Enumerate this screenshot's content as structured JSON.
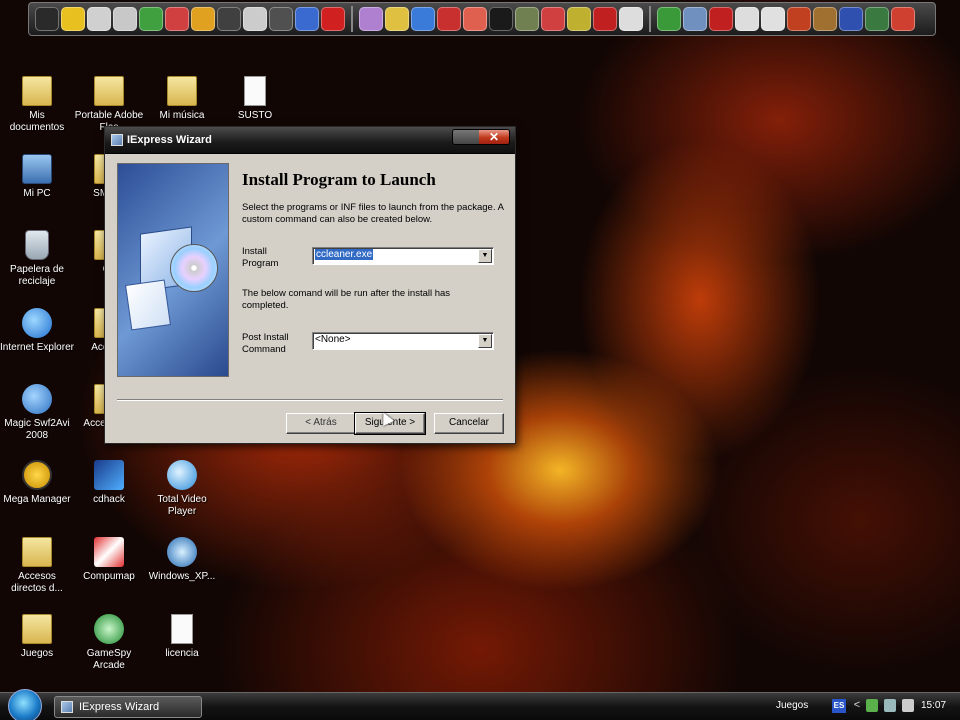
{
  "dock": {
    "icons": [
      "nes-icon",
      "cd-icon",
      "disc-icon",
      "flag-icon",
      "plant-icon",
      "mushroom-icon",
      "tool-icon",
      "linux-icon",
      "film-icon",
      "ninja-icon",
      "plane-icon",
      "circle-icon",
      "feather-icon",
      "camera-icon",
      "globe-icon",
      "car-icon",
      "paint-icon",
      "star-icon",
      "ninja2-icon",
      "flash-icon",
      "player-icon",
      "stop-icon",
      "wolf-icon",
      "globe2-icon",
      "map-icon",
      "cursor-icon",
      "disc2-icon",
      "monkey-icon",
      "warrior-icon",
      "wave-icon",
      "ball-icon",
      "net-icon",
      "orb-icon"
    ]
  },
  "desktop": {
    "icons": [
      {
        "label": "Mis\ndocumentos",
        "type": "folder"
      },
      {
        "label": "Portable Adobe Flas",
        "type": "folder"
      },
      {
        "label": "Mi música",
        "type": "folder"
      },
      {
        "label": "SUSTO",
        "type": "file"
      },
      {
        "label": "Mi PC",
        "type": "comp"
      },
      {
        "label": "SMV C",
        "type": "folder"
      },
      {
        "label": "Papelera de reciclaje",
        "type": "bin"
      },
      {
        "label": "Co",
        "type": "folder"
      },
      {
        "label": "Internet Explorer",
        "type": "ie"
      },
      {
        "label": "Acces a",
        "type": "folder"
      },
      {
        "label": "Magic Swf2Avi 2008",
        "type": "flash"
      },
      {
        "label": "Acces a vid",
        "type": "folder"
      },
      {
        "label": "Mega Manager",
        "type": "mega"
      },
      {
        "label": "cdhack",
        "type": "cd"
      },
      {
        "label": "Total Video Player",
        "type": "play"
      },
      {
        "label": "Accesos directos d...",
        "type": "folder"
      },
      {
        "label": "Compumap",
        "type": "compumap"
      },
      {
        "label": "Windows_XP...",
        "type": "winxp"
      },
      {
        "label": "Juegos",
        "type": "folder"
      },
      {
        "label": "GameSpy Arcade",
        "type": "gamespy"
      },
      {
        "label": "licencia",
        "type": "file"
      }
    ]
  },
  "dialog": {
    "title": "IExpress Wizard",
    "close_glyph": "✕",
    "heading": "Install Program to Launch",
    "description": "Select the programs or INF files to launch from the package.  A custom command can also be created below.",
    "install_label": "Install Program",
    "install_value": "ccleaner.exe",
    "note": "The below comand will be run after the install has completed.",
    "post_label": "Post Install Command",
    "post_value": "<None>",
    "arrow_glyph": "▼",
    "back_label": "< Atrás",
    "next_label": "Siguiente >",
    "cancel_label": "Cancelar"
  },
  "taskbar": {
    "window_label": "IExpress Wizard",
    "tray_label": "Juegos",
    "lang": "ES",
    "chevron": "<",
    "clock": "15:07"
  },
  "colors": {
    "selection": "#316ac5",
    "dialog_face": "#d4d0c8",
    "close_red": "#c0391c"
  }
}
